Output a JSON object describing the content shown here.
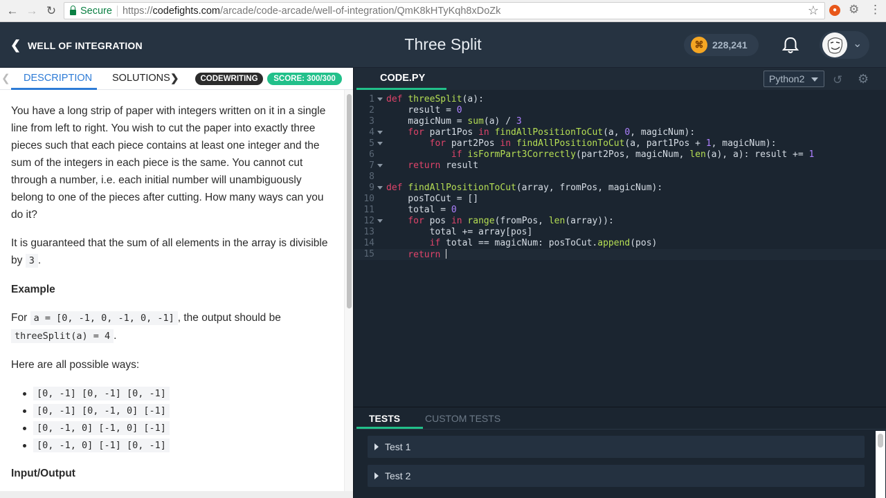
{
  "browser": {
    "secure_label": "Secure",
    "url_scheme": "https://",
    "url_domain": "codefights.com",
    "url_path": "/arcade/code-arcade/well-of-integration/QmK8kHTyKqh8xDoZk"
  },
  "header": {
    "back_label": "WELL OF INTEGRATION",
    "title": "Three Split",
    "coins": "228,241"
  },
  "left_panel": {
    "tabs": {
      "description": "DESCRIPTION",
      "solutions": "SOLUTIONS"
    },
    "badges": {
      "mode": "CODEWRITING",
      "score": "SCORE: 300/300"
    },
    "description": {
      "intro": "You have a long strip of paper with integers written on it in a single line from left to right. You wish to cut the paper into exactly three pieces such that each piece contains at least one integer and the sum of the integers in each piece is the same. You cannot cut through a number, i.e. each initial number will unambiguously belong to one of the pieces after cutting. How many ways can you do it?",
      "guarantee_pre": "It is guaranteed that the sum of all elements in the array is divisible by",
      "guarantee_code": "3",
      "guarantee_post": ".",
      "example_heading": "Example",
      "for_word": "For",
      "example_input": "a = [0, -1, 0, -1, 0, -1]",
      "output_text": ", the output should be",
      "example_output": "threeSplit(a) = 4",
      "example_end": ".",
      "ways_intro": "Here are all possible ways:",
      "ways": [
        "[0, -1] [0, -1] [0, -1]",
        "[0, -1] [0, -1, 0] [-1]",
        "[0, -1, 0] [-1, 0] [-1]",
        "[0, -1, 0] [-1] [0, -1]"
      ],
      "io_heading": "Input/Output"
    }
  },
  "editor": {
    "tab": "CODE.PY",
    "language": "Python2",
    "lines": [
      {
        "n": "1",
        "fold": true,
        "t": [
          [
            "kw",
            "def "
          ],
          [
            "fn",
            "threeSplit"
          ],
          [
            "tx",
            "(a):"
          ]
        ]
      },
      {
        "n": "2",
        "fold": false,
        "t": [
          [
            "tx",
            "    result = "
          ],
          [
            "num",
            "0"
          ]
        ]
      },
      {
        "n": "3",
        "fold": false,
        "t": [
          [
            "tx",
            "    magicNum = "
          ],
          [
            "fn",
            "sum"
          ],
          [
            "tx",
            "(a) / "
          ],
          [
            "num",
            "3"
          ]
        ]
      },
      {
        "n": "4",
        "fold": true,
        "t": [
          [
            "kw",
            "    for "
          ],
          [
            "tx",
            "part1Pos "
          ],
          [
            "kw",
            "in "
          ],
          [
            "fn",
            "findAllPositionToCut"
          ],
          [
            "tx",
            "(a, "
          ],
          [
            "num",
            "0"
          ],
          [
            "tx",
            ", magicNum):"
          ]
        ]
      },
      {
        "n": "5",
        "fold": true,
        "t": [
          [
            "kw",
            "        for "
          ],
          [
            "tx",
            "part2Pos "
          ],
          [
            "kw",
            "in "
          ],
          [
            "fn",
            "findAllPositionToCut"
          ],
          [
            "tx",
            "(a, part1Pos + "
          ],
          [
            "num",
            "1"
          ],
          [
            "tx",
            ", magicNum):"
          ]
        ]
      },
      {
        "n": "6",
        "fold": false,
        "t": [
          [
            "kw",
            "            if "
          ],
          [
            "fn",
            "isFormPart3Correctly"
          ],
          [
            "tx",
            "(part2Pos, magicNum, "
          ],
          [
            "fn",
            "len"
          ],
          [
            "tx",
            "(a), a): result += "
          ],
          [
            "num",
            "1"
          ]
        ]
      },
      {
        "n": "7",
        "fold": true,
        "t": [
          [
            "kw",
            "    return "
          ],
          [
            "tx",
            "result"
          ]
        ]
      },
      {
        "n": "8",
        "fold": false,
        "t": []
      },
      {
        "n": "9",
        "fold": true,
        "t": [
          [
            "kw",
            "def "
          ],
          [
            "fn",
            "findAllPositionToCut"
          ],
          [
            "tx",
            "(array, fromPos, magicNum):"
          ]
        ]
      },
      {
        "n": "10",
        "fold": false,
        "t": [
          [
            "tx",
            "    posToCut = []"
          ]
        ]
      },
      {
        "n": "11",
        "fold": false,
        "t": [
          [
            "tx",
            "    total = "
          ],
          [
            "num",
            "0"
          ]
        ]
      },
      {
        "n": "12",
        "fold": true,
        "t": [
          [
            "kw",
            "    for "
          ],
          [
            "tx",
            "pos "
          ],
          [
            "kw",
            "in "
          ],
          [
            "fn",
            "range"
          ],
          [
            "tx",
            "(fromPos, "
          ],
          [
            "fn",
            "len"
          ],
          [
            "tx",
            "(array)):"
          ]
        ]
      },
      {
        "n": "13",
        "fold": false,
        "t": [
          [
            "tx",
            "        total += array[pos]"
          ]
        ]
      },
      {
        "n": "14",
        "fold": false,
        "t": [
          [
            "kw",
            "        if "
          ],
          [
            "tx",
            "total == magicNum: posToCut."
          ],
          [
            "fn",
            "append"
          ],
          [
            "tx",
            "(pos)"
          ]
        ]
      },
      {
        "n": "15",
        "fold": false,
        "t": [
          [
            "kw",
            "    return "
          ]
        ],
        "cursor": true
      }
    ]
  },
  "tests": {
    "tabs": {
      "tests": "TESTS",
      "custom": "CUSTOM TESTS"
    },
    "items": [
      "Test 1",
      "Test 2"
    ]
  },
  "colors": {
    "accent_blue": "#2d7bd6",
    "accent_green": "#22c08a",
    "header_bg": "#263341",
    "editor_bg": "#1b2530"
  },
  "icons": [
    "back-icon",
    "forward-icon",
    "reload-icon",
    "lock-icon",
    "star-icon",
    "coin-icon",
    "bell-icon",
    "avatar",
    "chevron-down-icon",
    "reset-icon",
    "gear-icon",
    "caret-right-icon"
  ]
}
